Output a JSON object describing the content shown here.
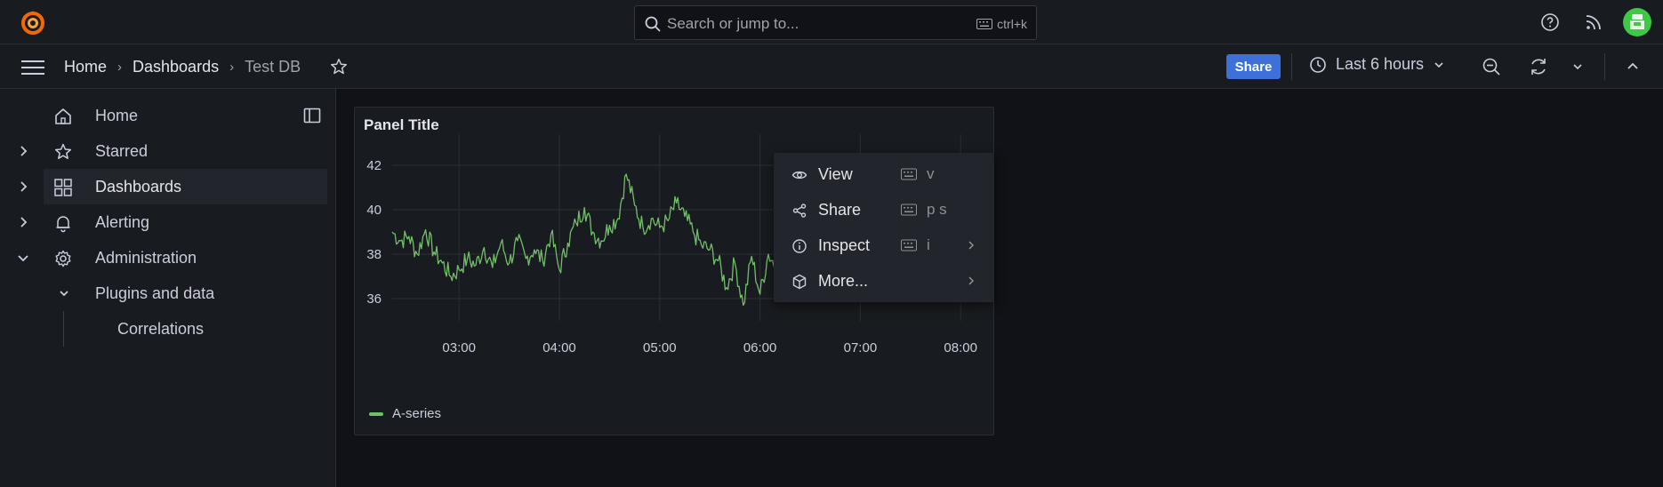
{
  "topbar": {
    "search_placeholder": "Search or jump to...",
    "search_shortcut": "ctrl+k"
  },
  "navbar": {
    "breadcrumbs": [
      "Home",
      "Dashboards",
      "Test DB"
    ],
    "share_label": "Share",
    "time_range": "Last 6 hours"
  },
  "sidebar": {
    "items": [
      {
        "label": "Home",
        "icon": "home-icon"
      },
      {
        "label": "Starred",
        "icon": "star-icon"
      },
      {
        "label": "Dashboards",
        "icon": "apps-icon"
      },
      {
        "label": "Alerting",
        "icon": "bell-icon"
      },
      {
        "label": "Administration",
        "icon": "cog-icon"
      },
      {
        "label": "Plugins and data"
      },
      {
        "label": "Correlations"
      }
    ]
  },
  "panel": {
    "title": "Panel Title",
    "legend": "A-series"
  },
  "menu": {
    "items": [
      {
        "label": "View",
        "shortcut": "v",
        "icon": "eye-icon"
      },
      {
        "label": "Share",
        "shortcut": "p s",
        "icon": "share-alt-icon"
      },
      {
        "label": "Inspect",
        "shortcut": "i",
        "icon": "info-circle-icon"
      },
      {
        "label": "More...",
        "shortcut": "",
        "icon": "cube-icon"
      }
    ]
  },
  "colors": {
    "accent": "#f55f3e",
    "series": "#73bf69",
    "share_button": "#3d71d9",
    "avatar": "#3cc944"
  },
  "chart_data": {
    "type": "line",
    "title": "Panel Title",
    "xlabel": "",
    "ylabel": "",
    "x_ticks": [
      "03:00",
      "04:00",
      "05:00",
      "06:00",
      "07:00",
      "08:00"
    ],
    "y_ticks": [
      36,
      38,
      40,
      42
    ],
    "ylim": [
      35,
      43
    ],
    "legend": "bottom-left",
    "grid": true,
    "series": [
      {
        "name": "A-series",
        "color": "#73bf69",
        "points": [
          [
            "02:20",
            39.0
          ],
          [
            "02:25",
            38.6
          ],
          [
            "02:30",
            38.8
          ],
          [
            "02:35",
            38.0
          ],
          [
            "02:40",
            39.1
          ],
          [
            "02:45",
            38.1
          ],
          [
            "02:50",
            37.6
          ],
          [
            "02:55",
            37.0
          ],
          [
            "03:00",
            37.3
          ],
          [
            "03:05",
            37.8
          ],
          [
            "03:10",
            37.5
          ],
          [
            "03:15",
            38.3
          ],
          [
            "03:20",
            37.4
          ],
          [
            "03:25",
            38.5
          ],
          [
            "03:30",
            37.6
          ],
          [
            "03:35",
            38.6
          ],
          [
            "03:40",
            37.8
          ],
          [
            "03:45",
            38.2
          ],
          [
            "03:50",
            37.7
          ],
          [
            "03:55",
            38.9
          ],
          [
            "04:00",
            37.3
          ],
          [
            "04:05",
            38.5
          ],
          [
            "04:10",
            39.4
          ],
          [
            "04:15",
            40.1
          ],
          [
            "04:20",
            39.0
          ],
          [
            "04:25",
            38.6
          ],
          [
            "04:30",
            39.3
          ],
          [
            "04:35",
            39.6
          ],
          [
            "04:40",
            41.6
          ],
          [
            "04:45",
            40.2
          ],
          [
            "04:50",
            39.2
          ],
          [
            "04:55",
            39.6
          ],
          [
            "05:00",
            39.2
          ],
          [
            "05:05",
            39.5
          ],
          [
            "05:10",
            40.3
          ],
          [
            "05:15",
            39.7
          ],
          [
            "05:20",
            39.0
          ],
          [
            "05:25",
            38.4
          ],
          [
            "05:30",
            38.2
          ],
          [
            "05:35",
            37.7
          ],
          [
            "05:40",
            36.5
          ],
          [
            "05:45",
            37.6
          ],
          [
            "05:50",
            35.7
          ],
          [
            "05:55",
            37.9
          ],
          [
            "06:00",
            36.2
          ],
          [
            "06:05",
            38.0
          ],
          [
            "06:10",
            37.4
          ],
          [
            "06:15",
            37.6
          ],
          [
            "06:20",
            36.5
          ],
          [
            "06:25",
            37.9
          ]
        ]
      }
    ]
  }
}
